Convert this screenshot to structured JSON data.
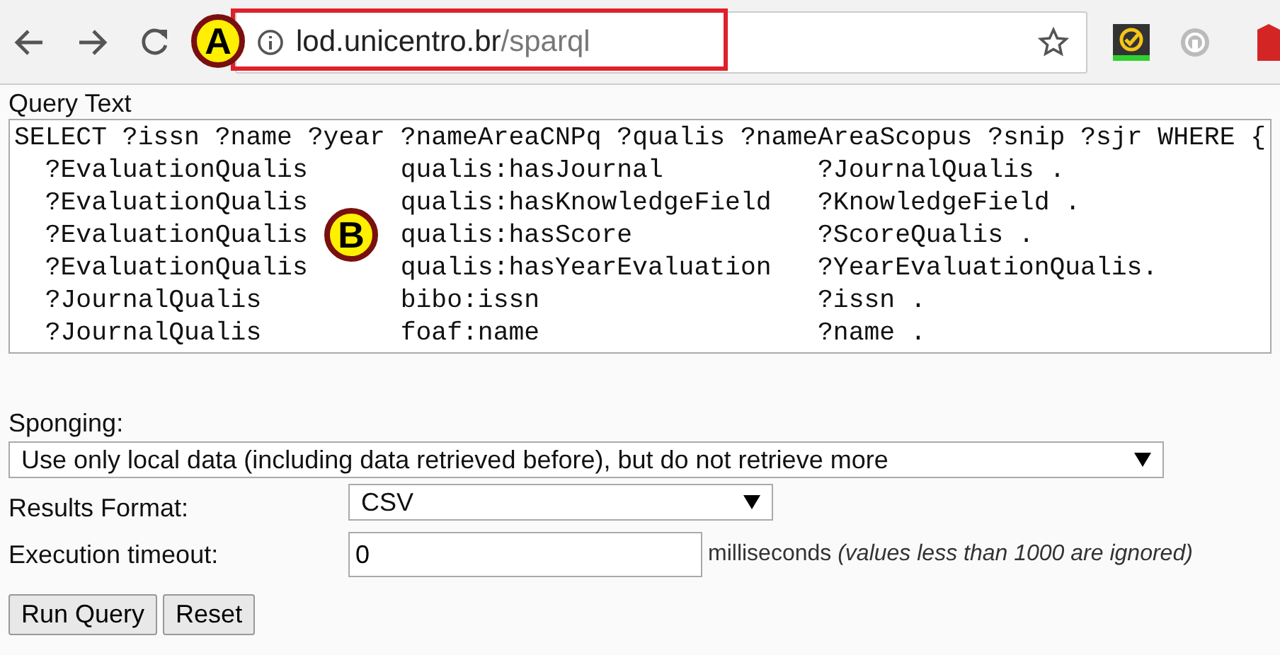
{
  "browser": {
    "url_host": "lod.unicentro.br",
    "url_path": "/sparql",
    "callout": "A"
  },
  "query": {
    "label": "Query Text",
    "lines": [
      [
        "SELECT ?issn ?name ?year ?nameAreaCNPq ?qualis ?nameAreaScopus ?snip ?sjr WHERE {"
      ],
      [
        "?EvaluationQualis",
        "qualis:hasJournal",
        "?JournalQualis ."
      ],
      [
        "?EvaluationQualis",
        "qualis:hasKnowledgeField",
        "?KnowledgeField ."
      ],
      [
        "?EvaluationQualis",
        "qualis:hasScore",
        "?ScoreQualis ."
      ],
      [
        "?EvaluationQualis",
        "qualis:hasYearEvaluation",
        "?YearEvaluationQualis."
      ],
      [
        "?JournalQualis",
        "bibo:issn",
        "?issn ."
      ],
      [
        "?JournalQualis",
        "foaf:name",
        "?name ."
      ]
    ],
    "callout": "B"
  },
  "sponging": {
    "label": "Sponging:",
    "value": "Use only local data (including data retrieved before), but do not retrieve more"
  },
  "format": {
    "label": "Results Format:",
    "value": "CSV"
  },
  "timeout": {
    "label": "Execution timeout:",
    "value": "0",
    "unit": "milliseconds",
    "note": "(values less than 1000 are ignored)"
  },
  "buttons": [
    "Run Query",
    "Reset"
  ]
}
